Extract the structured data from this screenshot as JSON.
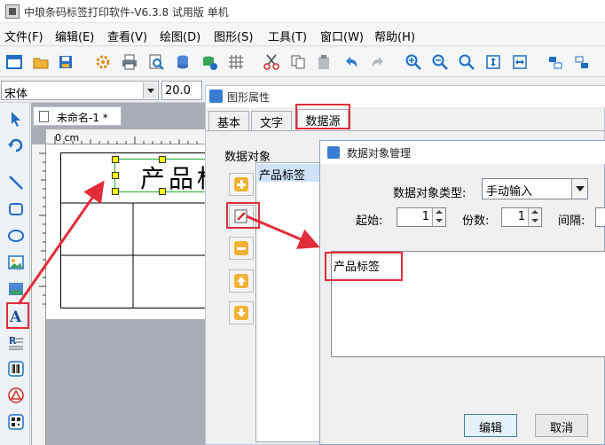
{
  "app": {
    "title": "中琅条码标签打印软件-V6.3.8 试用版 单机"
  },
  "menu": [
    "文件(F)",
    "编辑(E)",
    "查看(V)",
    "绘图(D)",
    "图形(S)",
    "工具(T)",
    "窗口(W)",
    "帮助(H)"
  ],
  "toolbar_icons": [
    "new-icon",
    "open-icon",
    "save-icon",
    "settings-icon",
    "print-icon",
    "print-preview-icon",
    "database-icon",
    "database-connect-icon",
    "grid-icon",
    "cut-icon",
    "copy-icon",
    "paste-icon",
    "undo-icon",
    "redo-icon",
    "zoom-in-icon",
    "zoom-out-icon",
    "zoom-fit-icon",
    "fit-page-icon",
    "fit-width-icon",
    "align-icon",
    "align-right-icon"
  ],
  "fontbar": {
    "font_name": "宋体",
    "font_size": "20.0"
  },
  "left_tools": [
    "select-icon",
    "rotate-icon",
    "line-icon",
    "rectangle-icon",
    "ellipse-icon",
    "image-icon",
    "image-library-icon",
    "text-icon",
    "rich-text-icon",
    "barcode-icon",
    "shape-icon",
    "qrcode-icon"
  ],
  "document": {
    "tab_title": "未命名-1 *",
    "ruler_unit": "0 cm",
    "text_object": "产品标签"
  },
  "shape_properties": {
    "title": "图形属性",
    "tabs": [
      "基本",
      "文字",
      "数据源"
    ],
    "active_tab": "数据源",
    "data_objects_label": "数据对象",
    "data_objects": [
      "产品标签"
    ]
  },
  "data_object_management": {
    "title": "数据对象管理",
    "type_label": "数据对象类型:",
    "type_value": "手动输入",
    "start_label": "起始:",
    "start_value": "1",
    "copies_label": "份数:",
    "copies_value": "1",
    "interval_label": "间隔:",
    "content": "产品标签",
    "edit_button": "编辑",
    "cancel_button": "取消"
  },
  "colors": {
    "highlight_red": "#e12d39",
    "selection_green": "#1fae28",
    "accent_blue": "#3a7bd5"
  }
}
